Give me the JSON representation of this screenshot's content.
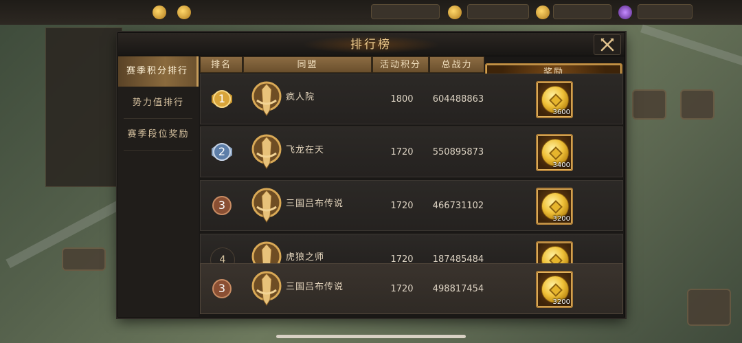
{
  "panel": {
    "title": "排行榜",
    "tabs": [
      {
        "label": "赛季积分排行",
        "active": true
      },
      {
        "label": "势力值排行",
        "active": false
      },
      {
        "label": "赛季段位奖励",
        "active": false
      }
    ],
    "columns": {
      "rank": "排名",
      "alliance": "同盟",
      "score": "活动积分",
      "power": "总战力",
      "reward": "奖励"
    },
    "rows": [
      {
        "rank": "1",
        "rank_style": "gold",
        "alliance": "疯人院",
        "score": "1800",
        "power": "604488863",
        "reward_qty": "3600"
      },
      {
        "rank": "2",
        "rank_style": "silver",
        "alliance": "飞龙在天",
        "score": "1720",
        "power": "550895873",
        "reward_qty": "3400"
      },
      {
        "rank": "3",
        "rank_style": "bronze",
        "alliance": "三国吕布传说",
        "score": "1720",
        "power": "466731102",
        "reward_qty": "3200"
      },
      {
        "rank": "4",
        "rank_style": "plain",
        "alliance": "虎狼之师",
        "score": "1720",
        "power": "187485484",
        "reward_qty": ""
      }
    ],
    "my_row": {
      "rank": "3",
      "rank_style": "bronze",
      "alliance": "三国吕布传说",
      "score": "1720",
      "power": "498817454",
      "reward_qty": "3200"
    }
  },
  "colors": {
    "gold": "#c9962f",
    "silver": "#5d7ea8",
    "bronze": "#8a4f33",
    "header_brown": "#7a5c36"
  },
  "icons": {
    "close": "close-icon",
    "rank_badge": "rank-medal-icon",
    "alliance_emblem": "alliance-emblem-icon",
    "reward_item": "gold-coin-icon"
  }
}
